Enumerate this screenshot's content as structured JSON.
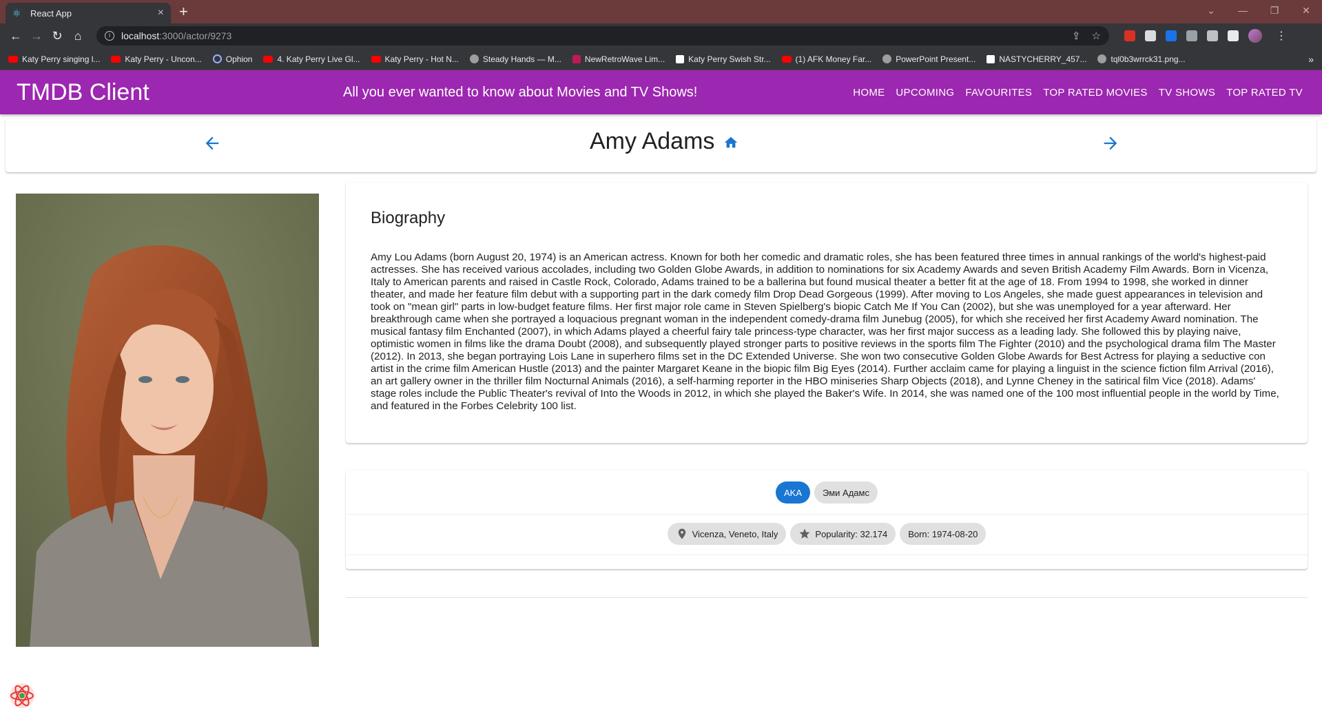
{
  "browser": {
    "tab_title": "React App",
    "url_host": "localhost",
    "url_path": ":3000/actor/9273",
    "bookmarks": [
      {
        "label": "Katy Perry singing l...",
        "icon": "youtube"
      },
      {
        "label": "Katy Perry - Uncon...",
        "icon": "youtube"
      },
      {
        "label": "Ophion",
        "icon": "circle"
      },
      {
        "label": "4. Katy Perry Live Gl...",
        "icon": "youtube"
      },
      {
        "label": "Katy Perry - Hot N...",
        "icon": "youtube"
      },
      {
        "label": "Steady Hands — M...",
        "icon": "gray"
      },
      {
        "label": "NewRetroWave Lim...",
        "icon": "k"
      },
      {
        "label": "Katy Perry Swish Str...",
        "icon": "medium"
      },
      {
        "label": "(1) AFK Money Far...",
        "icon": "youtube"
      },
      {
        "label": "PowerPoint Present...",
        "icon": "gray"
      },
      {
        "label": "NASTYCHERRY_457...",
        "icon": "square"
      },
      {
        "label": "tql0b3wrrck31.png...",
        "icon": "gray"
      }
    ]
  },
  "appbar": {
    "title": "TMDB Client",
    "tagline": "All you ever wanted to know about Movies and TV Shows!",
    "nav": [
      "HOME",
      "UPCOMING",
      "FAVOURITES",
      "TOP RATED MOVIES",
      "TV SHOWS",
      "TOP RATED TV"
    ]
  },
  "header": {
    "name": "Amy Adams"
  },
  "biography": {
    "heading": "Biography",
    "text": "Amy Lou Adams (born August 20, 1974) is an American actress. Known for both her comedic and dramatic roles, she has been featured three times in annual rankings of the world's highest-paid actresses. She has received various accolades, including two Golden Globe Awards, in addition to nominations for six Academy Awards and seven British Academy Film Awards. Born in Vicenza, Italy to American parents and raised in Castle Rock, Colorado, Adams trained to be a ballerina but found musical theater a better fit at the age of 18. From 1994 to 1998, she worked in dinner theater, and made her feature film debut with a supporting part in the dark comedy film Drop Dead Gorgeous (1999). After moving to Los Angeles, she made guest appearances in television and took on \"mean girl\" parts in low-budget feature films. Her first major role came in Steven Spielberg's biopic Catch Me If You Can (2002), but she was unemployed for a year afterward. Her breakthrough came when she portrayed a loquacious pregnant woman in the independent comedy-drama film Junebug (2005), for which she received her first Academy Award nomination. The musical fantasy film Enchanted (2007), in which Adams played a cheerful fairy tale princess-type character, was her first major success as a leading lady. She followed this by playing naive, optimistic women in films like the drama Doubt (2008), and subsequently played stronger parts to positive reviews in the sports film The Fighter (2010) and the psychological drama film The Master (2012). In 2013, she began portraying Lois Lane in superhero films set in the DC Extended Universe. She won two consecutive Golden Globe Awards for Best Actress for playing a seductive con artist in the crime film American Hustle (2013) and the painter Margaret Keane in the biopic film Big Eyes (2014). Further acclaim came for playing a linguist in the science fiction film Arrival (2016), an art gallery owner in the thriller film Nocturnal Animals (2016), a self-harming reporter in the HBO miniseries Sharp Objects (2018), and Lynne Cheney in the satirical film Vice (2018). Adams' stage roles include the Public Theater's revival of Into the Woods in 2012, in which she played the Baker's Wife. In 2014, she was named one of the 100 most influential people in the world by Time, and featured in the Forbes Celebrity 100 list."
  },
  "details": {
    "aka_label": "AKA",
    "aka_names": [
      "Эми Адамс"
    ],
    "place_of_birth": "Vicenza, Veneto, Italy",
    "popularity": "Popularity: 32.174",
    "born": "Born: 1974-08-20"
  },
  "colors": {
    "appbar": "#9c27b0",
    "primary": "#1976d2",
    "tabbar": "#6b3a3a"
  }
}
